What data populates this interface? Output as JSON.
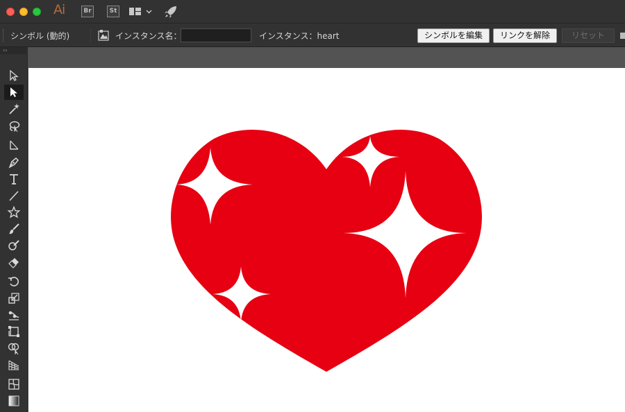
{
  "app": {
    "logo_text": "Ai",
    "bridge_label": "Br",
    "stock_label": "St",
    "icons": [
      "close-window",
      "minimize-window",
      "zoom-window",
      "workspace-switcher-icon",
      "chevron-down-icon",
      "rocket-icon"
    ]
  },
  "control_panel": {
    "symbol_type": "シンボル (動的)",
    "instance_name_label": "インスタンス名：",
    "instance_name_value": "",
    "instance_of": "インスタンス：heart",
    "edit_symbol_label": "シンボルを編集",
    "break_link_label": "リンクを解除",
    "reset_label": "リセット"
  },
  "tools": {
    "panel_toggle": "››",
    "items": [
      "selection-tool",
      "direct-selection-tool",
      "magic-wand-tool",
      "lasso-tool",
      "line-segment-tool",
      "pen-tool",
      "type-tool",
      "line-tool",
      "star-tool",
      "paintbrush-tool",
      "shaper-tool",
      "eraser-tool",
      "rotate-tool",
      "scale-tool",
      "puppet-warp-tool",
      "free-transform-tool",
      "shape-builder-tool",
      "perspective-grid-tool",
      "mesh-tool",
      "gradient-tool"
    ],
    "active": "direct-selection-tool"
  },
  "artwork": {
    "symbol_name": "heart",
    "heart_color": "#e60012",
    "sparkle_color": "#ffffff",
    "artboard_color": "#ffffff"
  }
}
